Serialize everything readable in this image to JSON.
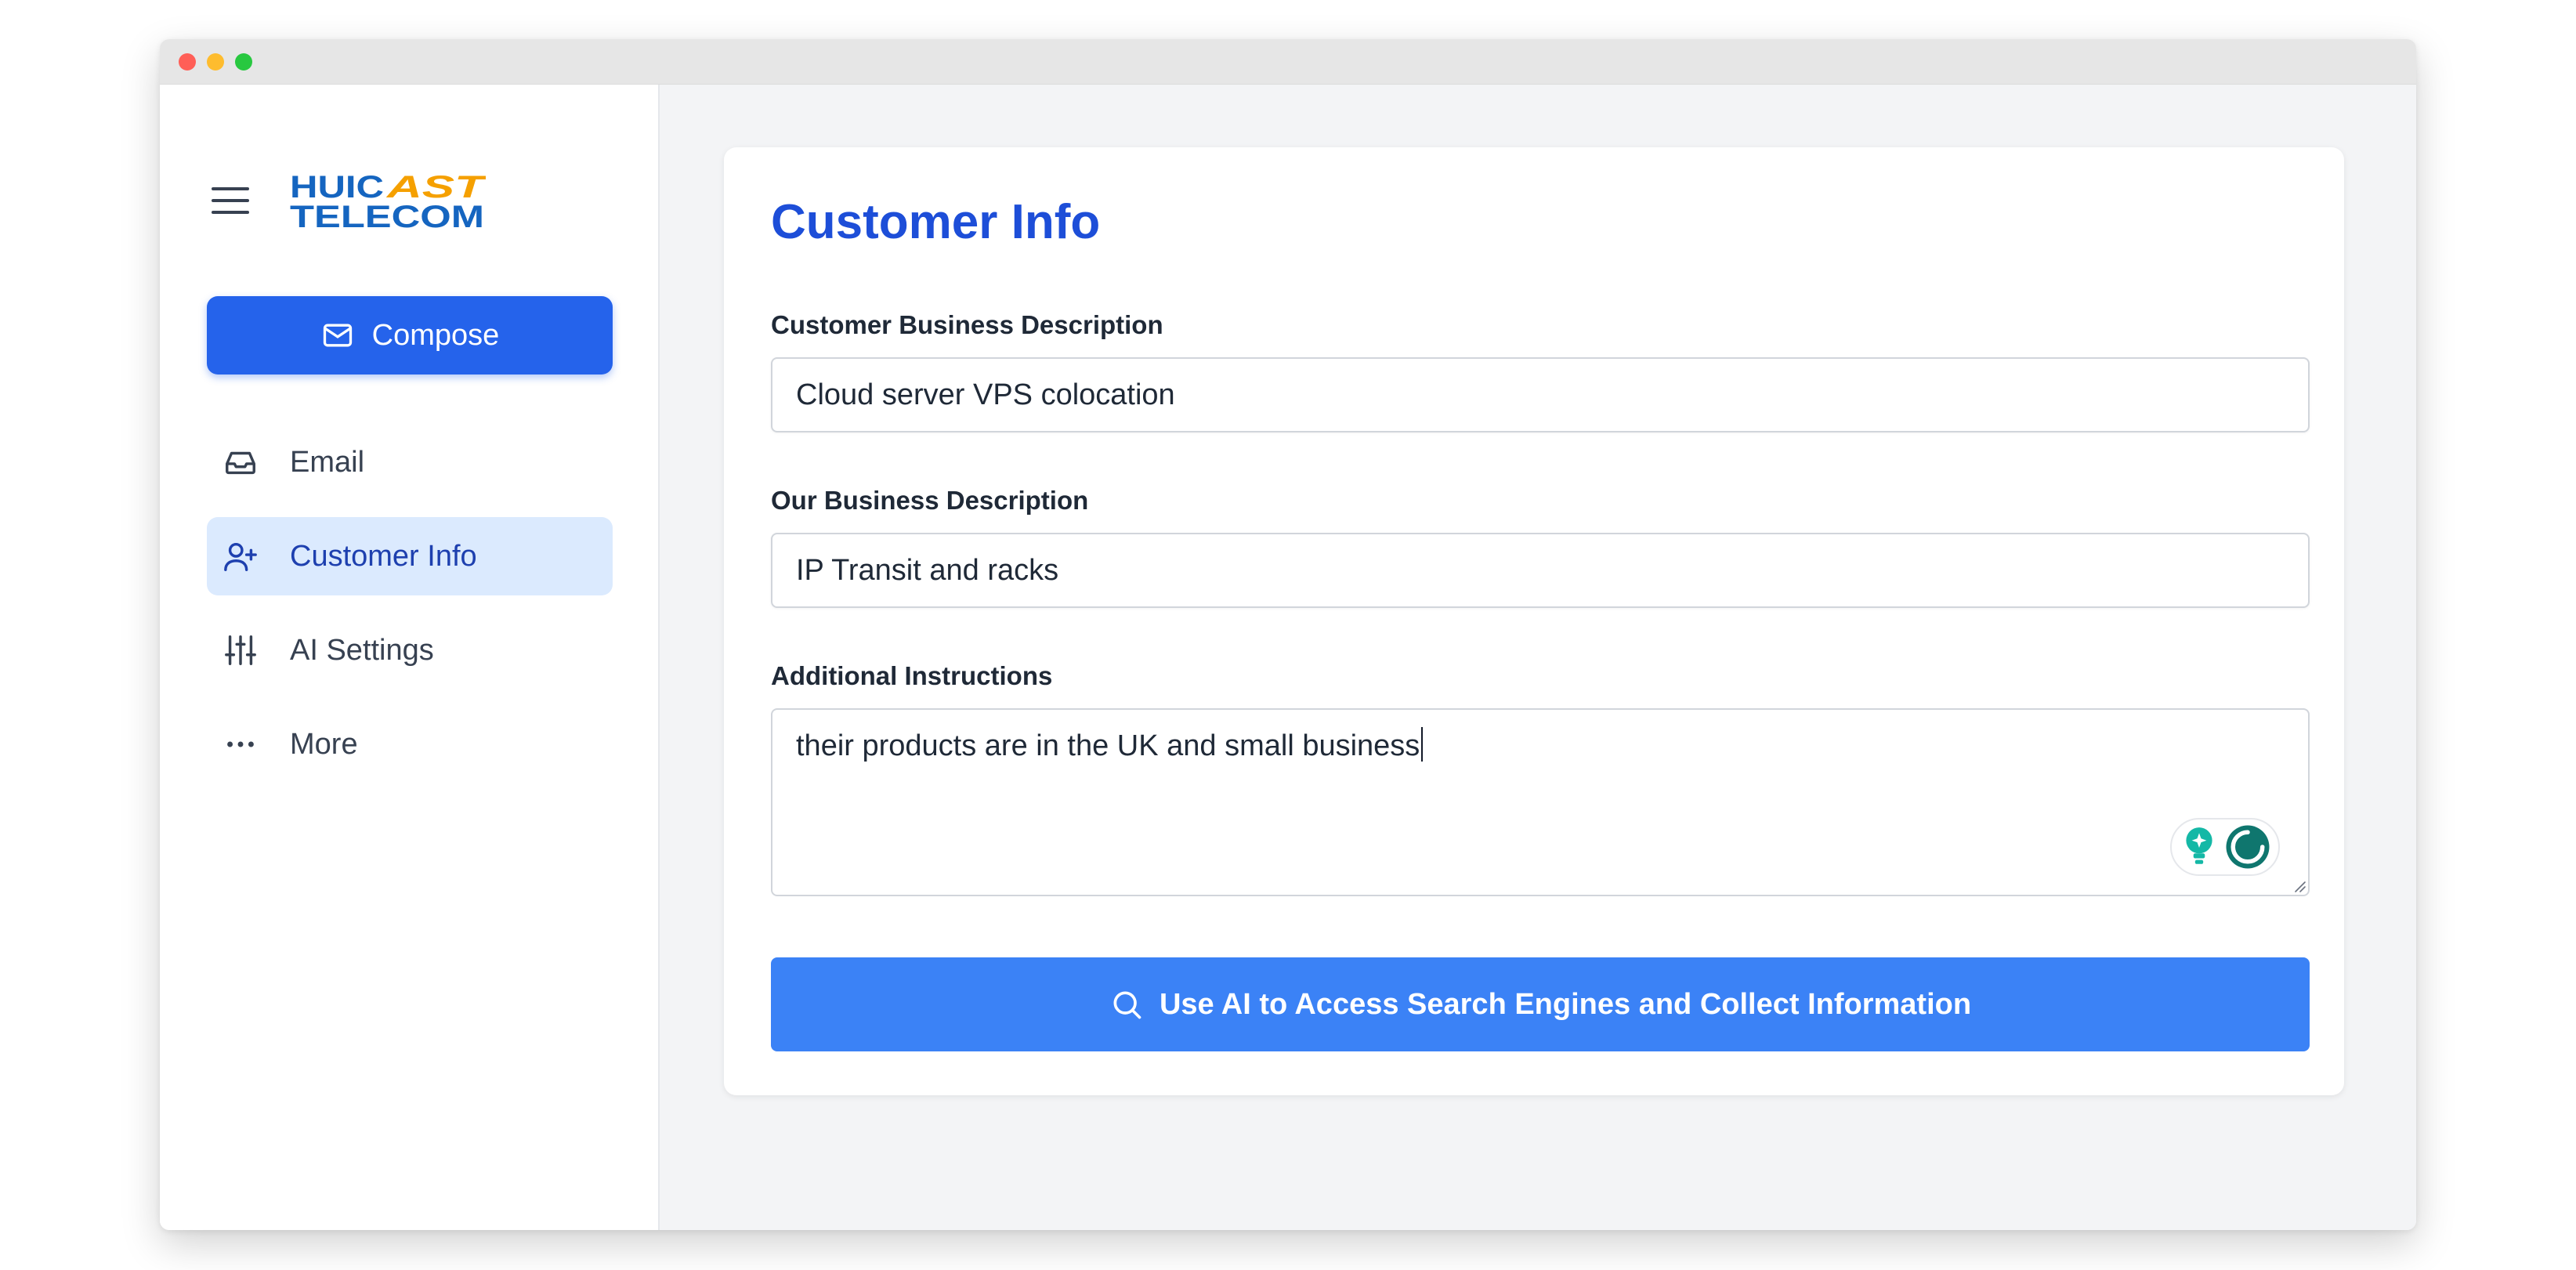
{
  "brand": {
    "logo_line1_a": "HUIC",
    "logo_line1_b": "AST",
    "logo_line2": "TELECOM",
    "color_blue": "#1565c0",
    "color_orange": "#f5a000"
  },
  "sidebar": {
    "compose_label": "Compose",
    "items": [
      {
        "label": "Email",
        "icon": "inbox-icon"
      },
      {
        "label": "Customer Info",
        "icon": "user-plus-icon",
        "active": true
      },
      {
        "label": "AI Settings",
        "icon": "sliders-icon"
      },
      {
        "label": "More",
        "icon": "more-dots-icon"
      }
    ]
  },
  "main": {
    "title": "Customer Info",
    "fields": [
      {
        "label": "Customer Business Description",
        "value": "Cloud server VPS colocation"
      },
      {
        "label": "Our Business Description",
        "value": "IP Transit and racks"
      },
      {
        "label": "Additional Instructions",
        "value": "their products are in the UK and small business"
      }
    ],
    "action_button": "Use AI to Access Search Engines and Collect Information"
  },
  "colors": {
    "accent": "#2563eb",
    "action": "#3b82f6",
    "title": "#1d4ed8",
    "active_bg": "#dbeafe"
  }
}
